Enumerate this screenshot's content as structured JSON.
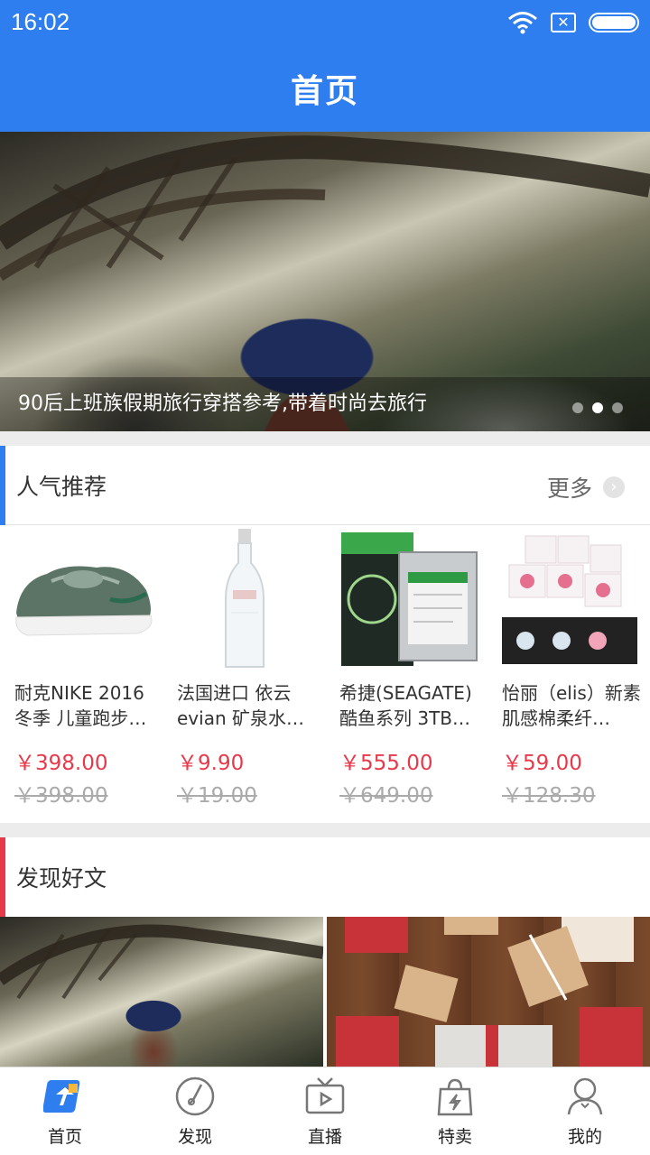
{
  "status_bar": {
    "time": "16:02",
    "icons": [
      "wifi-icon",
      "sim-x-icon",
      "battery-icon"
    ]
  },
  "header": {
    "title": "首页"
  },
  "banner": {
    "caption": "90后上班族假期旅行穿搭参考,带着时尚去旅行",
    "dots": 3,
    "active_dot": 2
  },
  "popular": {
    "title": "人气推荐",
    "more_label": "更多",
    "accent_color": "#2f7ef0",
    "products": [
      {
        "name": "耐克NIKE 2016冬季 儿童跑步…",
        "price": "￥398.00",
        "old_price": "￥398.00",
        "image": "sneaker-image"
      },
      {
        "name": "法国进口 依云evian 矿泉水…",
        "price": "￥9.90",
        "old_price": "￥19.00",
        "image": "water-bottle-image"
      },
      {
        "name": "希捷(SEAGATE)酷鱼系列 3TB…",
        "price": "￥555.00",
        "old_price": "￥649.00",
        "image": "hard-drive-image"
      },
      {
        "name": "怡丽（elis）新素肌感棉柔纤…",
        "price": "￥59.00",
        "old_price": "￥128.30",
        "image": "pads-package-image"
      }
    ]
  },
  "articles": {
    "title": "发现好文",
    "accent_color": "#e8394a",
    "items": [
      "travel-photo",
      "gift-boxes-photo"
    ]
  },
  "tabbar": {
    "active_color": "#2f7ef0",
    "items": [
      {
        "label": "首页",
        "icon": "home-icon"
      },
      {
        "label": "发现",
        "icon": "discover-icon"
      },
      {
        "label": "直播",
        "icon": "live-tv-icon"
      },
      {
        "label": "特卖",
        "icon": "sale-bag-icon"
      },
      {
        "label": "我的",
        "icon": "profile-icon"
      }
    ]
  }
}
